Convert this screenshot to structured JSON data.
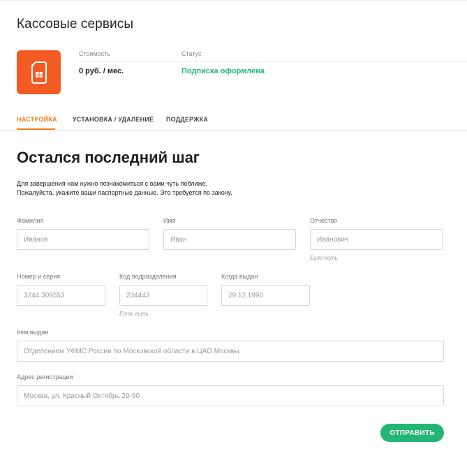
{
  "header": {
    "title": "Кассовые сервисы",
    "icon": "sim-card-icon",
    "accent_color": "#f35b22"
  },
  "meta": {
    "price_label": "Стоимость",
    "price_value": "0 руб. / мес.",
    "status_label": "Статус",
    "status_value": "Подписка оформлена",
    "status_color": "#22b573"
  },
  "tabs": [
    {
      "label": "НАСТРОЙКА",
      "active": true
    },
    {
      "label": "УСТАНОВКА / УДАЛЕНИЕ",
      "active": false
    },
    {
      "label": "ПОДДЕРЖКА",
      "active": false
    }
  ],
  "form": {
    "heading": "Остался последний шаг",
    "intro_line1": "Для завершения нам нужно познакомиться с вами чуть поближе.",
    "intro_line2": "Пожалуйста, укажите ваши паспортные данные. Это требуется по закону.",
    "last_name": {
      "label": "Фамилия",
      "placeholder": "Иванов"
    },
    "first_name": {
      "label": "Имя",
      "placeholder": "Иван"
    },
    "middle_name": {
      "label": "Отчество",
      "placeholder": "Иванович",
      "hint": "Если есть"
    },
    "passport_number": {
      "label": "Номер и серия",
      "placeholder": "3244 309553"
    },
    "division_code": {
      "label": "Код подразделения",
      "placeholder": "234443",
      "hint": "Есть есть"
    },
    "issue_date": {
      "label": "Когда выдан",
      "placeholder": "29.12.1990"
    },
    "issued_by": {
      "label": "Кем выдан",
      "placeholder": "Отделением УФМС России по Московской области в ЦАО Москвы"
    },
    "address": {
      "label": "Адрес регистрации",
      "placeholder": "Москва, ул. Красный Октябрь 20-90"
    },
    "submit_label": "ОТПРАВИТЬ"
  }
}
